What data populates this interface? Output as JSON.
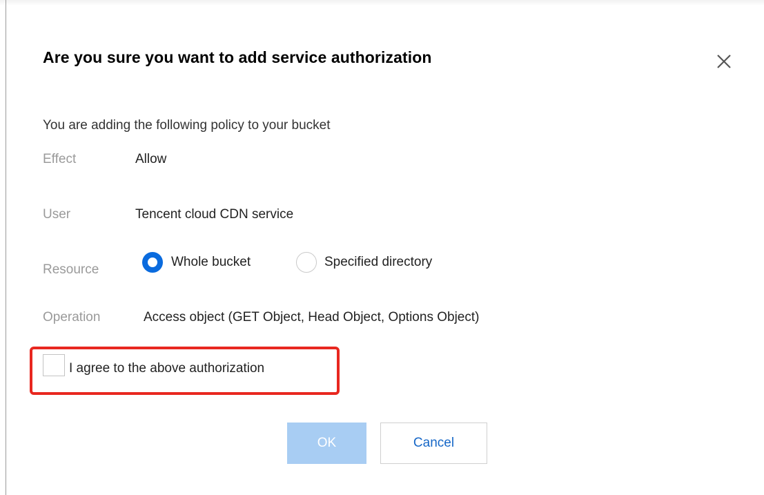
{
  "dialog": {
    "title": "Are you sure you want to add service authorization",
    "close_icon": "close-icon",
    "intro": "You are adding the following policy to your bucket",
    "fields": {
      "effect": {
        "label": "Effect",
        "value": "Allow"
      },
      "user": {
        "label": "User",
        "value": "Tencent cloud CDN service"
      },
      "resource": {
        "label": "Resource",
        "options": [
          {
            "label": "Whole bucket",
            "checked": true
          },
          {
            "label": "Specified directory",
            "checked": false
          }
        ]
      },
      "operation": {
        "label": "Operation",
        "value": "Access object (GET Object, Head Object, Options Object)"
      }
    },
    "agree": {
      "label": "I agree to the above authorization",
      "checked": false
    },
    "buttons": {
      "ok": "OK",
      "cancel": "Cancel"
    }
  },
  "colors": {
    "accent": "#0a6bde",
    "ok_disabled": "#a8cdf3",
    "highlight": "#e8271f",
    "label_gray": "#9a9a9a"
  }
}
